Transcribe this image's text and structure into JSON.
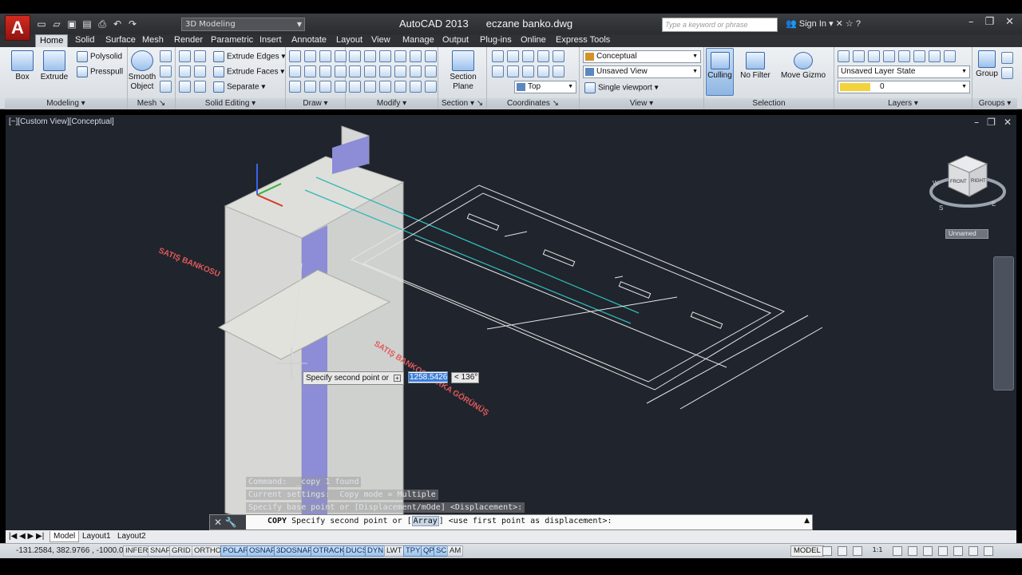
{
  "title": {
    "app": "AutoCAD 2013",
    "file": "eczane banko.dwg",
    "workspace": "3D Modeling",
    "search_placeholder": "Type a keyword or phrase",
    "sign_in": "Sign In"
  },
  "tabs": [
    "Home",
    "Solid",
    "Surface",
    "Mesh",
    "Render",
    "Parametric",
    "Insert",
    "Annotate",
    "Layout",
    "View",
    "Manage",
    "Output",
    "Plug-ins",
    "Online",
    "Express Tools"
  ],
  "ribbon": {
    "modeling": {
      "title": "Modeling",
      "box": "Box",
      "extrude": "Extrude",
      "polysolid": "Polysolid",
      "presspull": "Presspull"
    },
    "mesh": {
      "title": "Mesh",
      "smooth_object": "Smooth Object"
    },
    "solid_editing": {
      "title": "Solid Editing",
      "extrude_edges": "Extrude Edges",
      "extrude_faces": "Extrude Faces",
      "separate": "Separate"
    },
    "draw": {
      "title": "Draw"
    },
    "modify": {
      "title": "Modify"
    },
    "section": {
      "title": "Section",
      "section_plane": "Section Plane"
    },
    "coordinates": {
      "title": "Coordinates",
      "top": "Top"
    },
    "view": {
      "title": "View",
      "visual_style": "Conceptual",
      "saved_view": "Unsaved View",
      "viewport": "Single viewport"
    },
    "selection": {
      "title": "Selection",
      "culling": "Culling",
      "no_filter": "No Filter",
      "move_gizmo": "Move Gizmo"
    },
    "layers": {
      "title": "Layers",
      "layer_state": "Unsaved Layer State",
      "current_layer": "0"
    },
    "groups": {
      "title": "Groups",
      "group": "Group"
    }
  },
  "viewport": {
    "label": "[−][Custom View][Conceptual]",
    "cube_face_front": "FRONT",
    "cube_face_right": "RIGHT",
    "compass_w": "W",
    "compass_s": "S",
    "compass_e": "E",
    "ucs_name": "Unnamed",
    "annotation_1": "SATIŞ BANKOSU",
    "annotation_2": "SATIŞ BANKOSU ARKA GÖRÜNÜŞ"
  },
  "dynamic_input": {
    "prompt": "Specify second point or",
    "distance": "1258.5426",
    "angle": "< 136°"
  },
  "command_history": [
    "Command:  _copy 1 found",
    "Current settings:  Copy mode = Multiple",
    "Specify base point or [Displacement/mOde] <Displacement>:"
  ],
  "command_line": {
    "command": "COPY",
    "prompt_start": "Specify second point or [",
    "option": "Array",
    "prompt_end": "] <use first point as displacement>:"
  },
  "layout_tabs": [
    "Model",
    "Layout1",
    "Layout2"
  ],
  "status": {
    "coordinates": "-131.2584,  382.9766 ,  -1000.0000",
    "toggles": [
      "INFER",
      "SNAP",
      "GRID",
      "ORTHO",
      "POLAR",
      "OSNAP",
      "3DOSNAP",
      "OTRACK",
      "DUCS",
      "DYN",
      "LWT",
      "TPY",
      "QP",
      "SC",
      "AM"
    ],
    "toggles_on": [
      "POLAR",
      "OSNAP",
      "3DOSNAP",
      "OTRACK",
      "DUCS",
      "DYN",
      "TPY",
      "QP",
      "SC"
    ],
    "model": "MODEL",
    "scale": "1:1"
  }
}
